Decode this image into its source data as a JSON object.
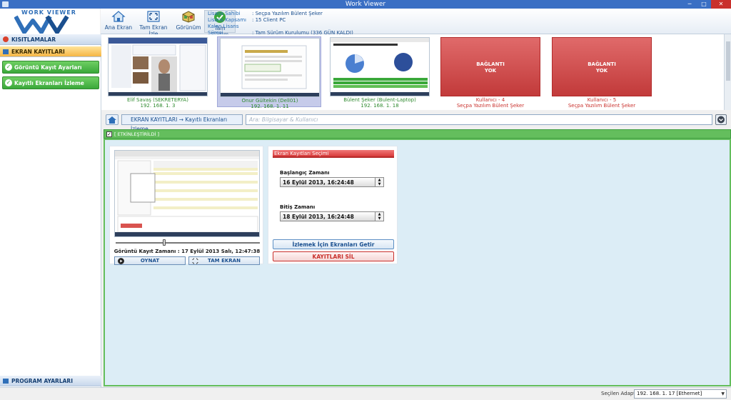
{
  "window": {
    "title": "Work Viewer"
  },
  "logo": {
    "text": "WORK VIEWER"
  },
  "ribbon": {
    "buttons": [
      "Ana Ekran",
      "Tam Ekran İzle",
      "Görünüm",
      "Tam Sürüm"
    ],
    "license": [
      {
        "key": "Lisans Sahibi",
        "value": ":  Seçpa Yazılım Bülent Şeker"
      },
      {
        "key": "Lisans Kapsamı",
        "value": ":  15 Client PC"
      },
      {
        "key": "Kalan Lisans Süresi",
        "value": ":  Tam Sürüm Kurulumu (336 GÜN KALDI)"
      }
    ]
  },
  "sidebar": {
    "sections": [
      "KISITLAMALAR",
      "EKRAN KAYITLARI",
      "PROGRAM AYARLARI"
    ],
    "items": [
      "Görüntü Kayıt Ayarları",
      "Kayıtlı Ekranları İzleme"
    ]
  },
  "clients": [
    {
      "name": "Elif Savaş (SEKRETERYA)",
      "ip": "192. 168. 1. 3",
      "status": "online"
    },
    {
      "name": "Onur Gültekin (Dell01)",
      "ip": "192. 168. 1. 11",
      "status": "online"
    },
    {
      "name": "Bülent Şeker (Bulent-Laptop)",
      "ip": "192. 168. 1. 18",
      "status": "online"
    },
    {
      "name": "Kullanıcı - 4",
      "ip": "Seçpa Yazılım Bülent Şeker",
      "status": "offline",
      "offline_text": "BAĞLANTI\nYOK"
    },
    {
      "name": "Kullanıcı - 5",
      "ip": "Seçpa Yazılım Bülent Şeker",
      "status": "offline",
      "offline_text": "BAĞLANTI\nYOK"
    }
  ],
  "nav": {
    "breadcrumb": "EKRAN KAYITLARI  →  Kayıtlı Ekranları İzleme",
    "search_placeholder": "Ara: Bilgisayar & Kullanıcı"
  },
  "panel": {
    "enabled_label": "[ ETKİNLEŞTİRİLDİ ]",
    "record_time_label": "Görüntü Kayıt Zamanı :  17 Eylül 2013 Salı,  12:47:38",
    "play_label": "OYNAT",
    "fullscreen_label": "TAM EKRAN",
    "selection_title": "Ekran Kayıtları Seçimi",
    "start_label": "Başlangıç Zamanı",
    "start_value": "16 Eylül 2013, 16:24:48",
    "end_label": "Bitiş Zamanı",
    "end_value": "18 Eylül 2013, 16:24:48",
    "fetch_label": "İzlemek İçin Ekranları Getir",
    "delete_label": "KAYITLARI SİL"
  },
  "status": {
    "adapter_label": "Seçilen Adaptör:",
    "adapter_value": "192. 168. 1. 17  [Ethernet]"
  },
  "colors": {
    "accent_green": "#64be5d",
    "offline_red": "#c23a3a",
    "brand_blue": "#2f6fb8"
  }
}
